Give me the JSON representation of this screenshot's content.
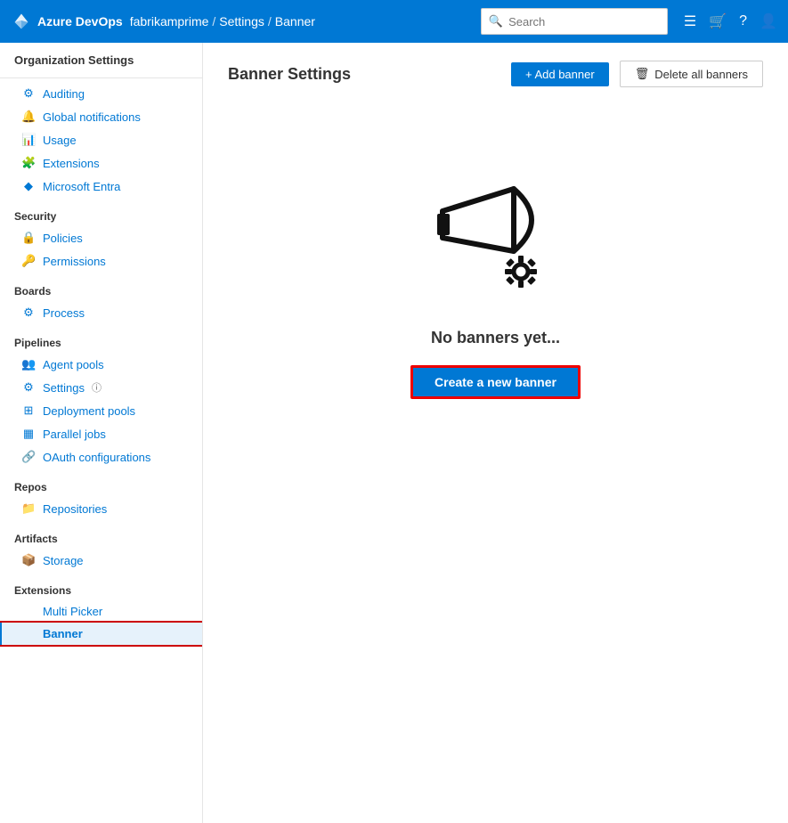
{
  "topbar": {
    "logo_text": "Azure DevOps",
    "breadcrumb": [
      "fabrikamprime",
      "Settings",
      "Banner"
    ],
    "search_placeholder": "Search"
  },
  "sidebar": {
    "title": "Organization Settings",
    "sections": [
      {
        "name": "",
        "items": [
          {
            "id": "auditing",
            "label": "Auditing",
            "icon": "⚙"
          },
          {
            "id": "global-notifications",
            "label": "Global notifications",
            "icon": "🔔"
          },
          {
            "id": "usage",
            "label": "Usage",
            "icon": "📊"
          },
          {
            "id": "extensions",
            "label": "Extensions",
            "icon": "🧩"
          },
          {
            "id": "microsoft-entra",
            "label": "Microsoft Entra",
            "icon": "◆"
          }
        ]
      },
      {
        "name": "Security",
        "items": [
          {
            "id": "policies",
            "label": "Policies",
            "icon": "🔒"
          },
          {
            "id": "permissions",
            "label": "Permissions",
            "icon": "🔑"
          }
        ]
      },
      {
        "name": "Boards",
        "items": [
          {
            "id": "process",
            "label": "Process",
            "icon": "⚙"
          }
        ]
      },
      {
        "name": "Pipelines",
        "items": [
          {
            "id": "agent-pools",
            "label": "Agent pools",
            "icon": "👥"
          },
          {
            "id": "settings",
            "label": "Settings",
            "icon": "⚙",
            "badge": "ⓘ"
          },
          {
            "id": "deployment-pools",
            "label": "Deployment pools",
            "icon": "⊞"
          },
          {
            "id": "parallel-jobs",
            "label": "Parallel jobs",
            "icon": "▦"
          },
          {
            "id": "oauth-configurations",
            "label": "OAuth configurations",
            "icon": "🔗"
          }
        ]
      },
      {
        "name": "Repos",
        "items": [
          {
            "id": "repositories",
            "label": "Repositories",
            "icon": "📁"
          }
        ]
      },
      {
        "name": "Artifacts",
        "items": [
          {
            "id": "storage",
            "label": "Storage",
            "icon": "📦"
          }
        ]
      },
      {
        "name": "Extensions",
        "items": [
          {
            "id": "multi-picker",
            "label": "Multi Picker",
            "icon": ""
          },
          {
            "id": "banner",
            "label": "Banner",
            "icon": "",
            "active": true
          }
        ]
      }
    ]
  },
  "content": {
    "title": "Banner Settings",
    "add_banner_label": "+ Add banner",
    "delete_all_label": "Delete all banners",
    "empty_state_text": "No banners yet...",
    "create_banner_label": "Create a new banner"
  }
}
